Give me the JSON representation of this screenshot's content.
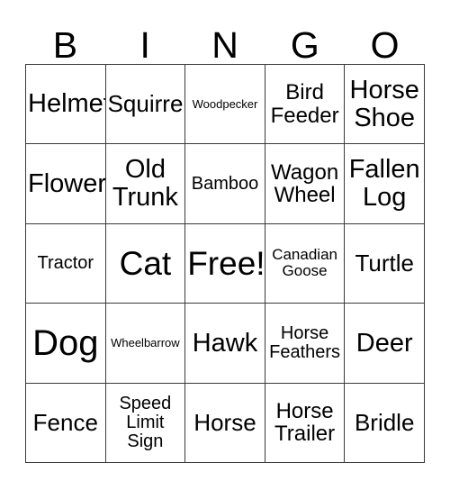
{
  "card": {
    "title": "BINGO",
    "headers": [
      "B",
      "I",
      "N",
      "G",
      "O"
    ],
    "free_space": "Free!",
    "colors": {
      "background": "#ffffff",
      "text": "#000000",
      "grid_line": "#3a3a3a"
    },
    "rows": [
      [
        {
          "label": "Helmet",
          "size": "l"
        },
        {
          "label": "Squirrel",
          "size": "ml"
        },
        {
          "label": "Woodpecker",
          "size": "xxs"
        },
        {
          "label": "Bird\nFeeder",
          "size": "m"
        },
        {
          "label": "Horse\nShoe",
          "size": "l"
        }
      ],
      [
        {
          "label": "Flower",
          "size": "l"
        },
        {
          "label": "Old\nTrunk",
          "size": "l"
        },
        {
          "label": "Bamboo",
          "size": "s"
        },
        {
          "label": "Wagon\nWheel",
          "size": "m"
        },
        {
          "label": "Fallen\nLog",
          "size": "l"
        }
      ],
      [
        {
          "label": "Tractor",
          "size": "s"
        },
        {
          "label": "Cat",
          "size": "xl"
        },
        {
          "label": "Free!",
          "size": "xl"
        },
        {
          "label": "Canadian\nGoose",
          "size": "xs"
        },
        {
          "label": "Turtle",
          "size": "ml"
        }
      ],
      [
        {
          "label": "Dog",
          "size": "xxl"
        },
        {
          "label": "Wheelbarrow",
          "size": "xxs"
        },
        {
          "label": "Hawk",
          "size": "l"
        },
        {
          "label": "Horse\nFeathers",
          "size": "s"
        },
        {
          "label": "Deer",
          "size": "l"
        }
      ],
      [
        {
          "label": "Fence",
          "size": "ml"
        },
        {
          "label": "Speed\nLimit\nSign",
          "size": "s"
        },
        {
          "label": "Horse",
          "size": "ml"
        },
        {
          "label": "Horse\nTrailer",
          "size": "m"
        },
        {
          "label": "Bridle",
          "size": "ml"
        }
      ]
    ]
  }
}
